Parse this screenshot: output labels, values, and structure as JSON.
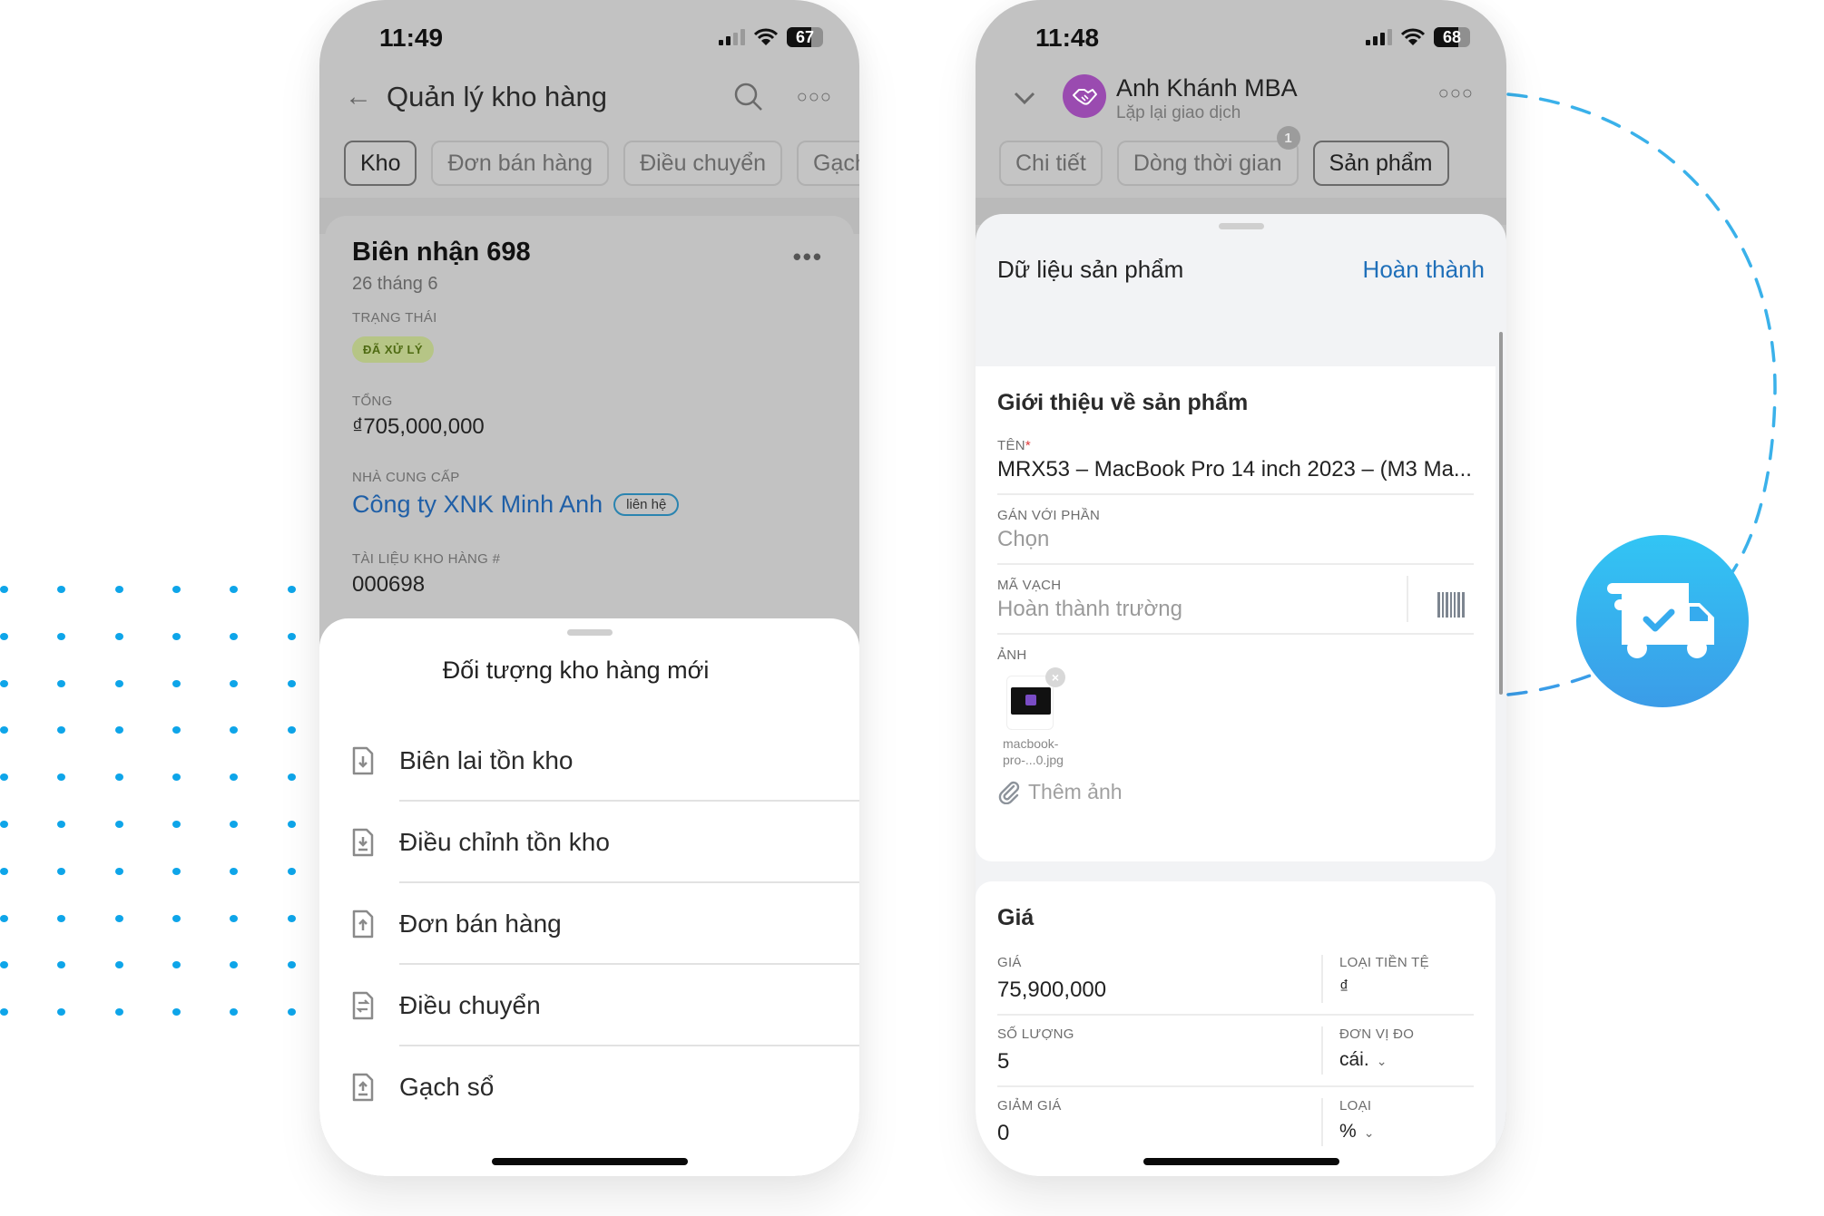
{
  "background": {
    "dot_color": "#0ea5e9",
    "accent_gradient": [
      "#32c5f4",
      "#3b9ce8"
    ],
    "badge_icon": "truck-check-icon"
  },
  "phone1": {
    "status": {
      "time": "11:49",
      "battery": "67"
    },
    "nav": {
      "back_icon": "arrow-left-icon",
      "title": "Quản lý kho hàng",
      "search_icon": "search-icon",
      "more_icon": "more-horizontal-icon"
    },
    "tabs": [
      {
        "label": "Kho",
        "active": true
      },
      {
        "label": "Đơn bán hàng",
        "active": false
      },
      {
        "label": "Điều chuyển",
        "active": false
      },
      {
        "label": "Gạch sổ",
        "active": false
      }
    ],
    "card": {
      "title": "Biên nhận 698",
      "date": "26 tháng 6",
      "status_label": "TRẠNG THÁI",
      "status_value": "ĐÃ XỬ LÝ",
      "total_label": "TỔNG",
      "total_value": "₫705,000,000",
      "supplier_label": "NHÀ CUNG CẤP",
      "supplier_value": "Công ty XNK Minh Anh",
      "supplier_contact": "liên hệ",
      "doc_label": "TÀI LIỆU KHO HÀNG #",
      "doc_value": "000698"
    },
    "sheet": {
      "title": "Đối tượng kho hàng mới",
      "items": [
        {
          "label": "Biên lai tồn kho",
          "icon": "file-download-icon"
        },
        {
          "label": "Điều chỉnh tồn kho",
          "icon": "file-import-icon"
        },
        {
          "label": "Đơn bán hàng",
          "icon": "file-upload-icon"
        },
        {
          "label": "Điều chuyển",
          "icon": "file-transfer-icon"
        },
        {
          "label": "Gạch sổ",
          "icon": "file-export-icon"
        }
      ]
    }
  },
  "phone2": {
    "status": {
      "time": "11:48",
      "battery": "68"
    },
    "nav": {
      "name": "Anh Khánh MBA",
      "subtitle": "Lặp lại giao dịch",
      "avatar_icon": "handshake-icon"
    },
    "tabs": [
      {
        "label": "Chi tiết",
        "active": false
      },
      {
        "label": "Dòng thời gian",
        "active": false,
        "badge": "1"
      },
      {
        "label": "Sản phẩm",
        "active": true
      }
    ],
    "sheet": {
      "title": "Dữ liệu sản phẩm",
      "done": "Hoàn thành",
      "intro": {
        "title": "Giới thiệu về sản phẩm",
        "name_label": "TÊN",
        "name_required": "*",
        "name_value": "MRX53 – MacBook Pro 14 inch 2023 – (M3 Ma...",
        "assign_label": "GÁN VỚI PHẦN",
        "assign_placeholder": "Chọn",
        "barcode_label": "MÃ VẠCH",
        "barcode_placeholder": "Hoàn thành trường",
        "photo_label": "ẢNH",
        "photo_file_line1": "macbook-",
        "photo_file_line2": "pro-...0.jpg",
        "add_photo": "Thêm ảnh"
      },
      "price": {
        "title": "Giá",
        "price_label": "GIÁ",
        "price_value": "75,900,000",
        "currency_label": "LOẠI TIỀN TỆ",
        "currency_value": "₫",
        "qty_label": "SỐ LƯỢNG",
        "qty_value": "5",
        "unit_label": "ĐƠN VỊ ĐO",
        "unit_value": "cái.",
        "discount_label": "GIẢM GIÁ",
        "discount_value": "0",
        "type_label": "LOẠI",
        "type_value": "%"
      }
    }
  }
}
